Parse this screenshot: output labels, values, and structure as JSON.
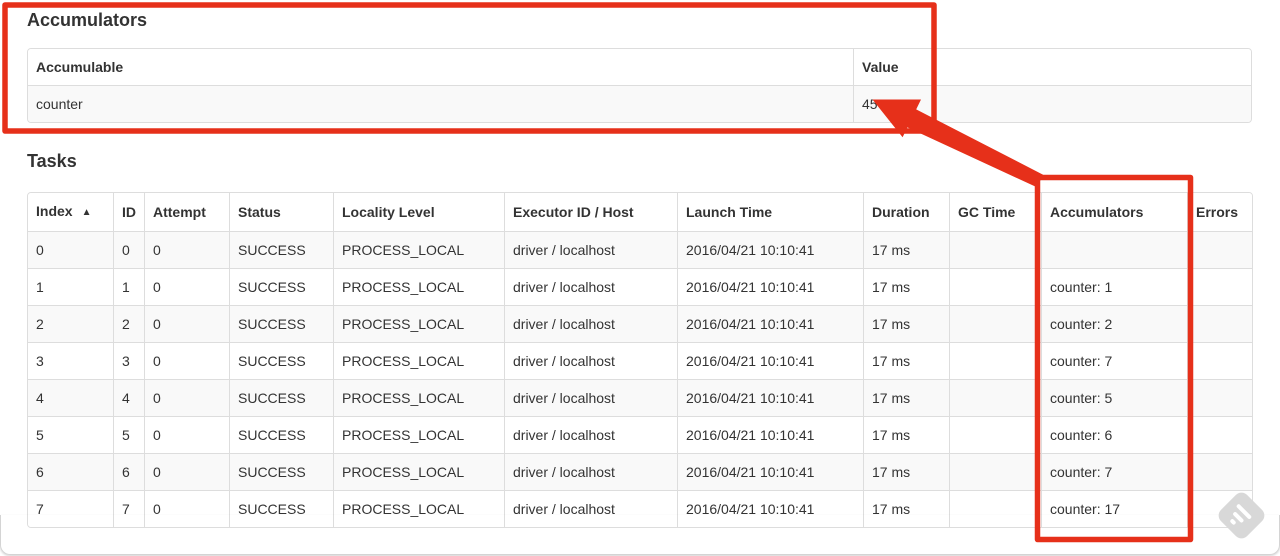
{
  "accumulators_section": {
    "heading": "Accumulators",
    "table": {
      "headers": [
        "Accumulable",
        "Value"
      ],
      "rows": [
        {
          "accumulable": "counter",
          "value": "45"
        }
      ]
    }
  },
  "tasks_section": {
    "heading": "Tasks",
    "table": {
      "sort_indicator": "▲",
      "headers": [
        "Index",
        "ID",
        "Attempt",
        "Status",
        "Locality Level",
        "Executor ID / Host",
        "Launch Time",
        "Duration",
        "GC Time",
        "Accumulators",
        "Errors"
      ],
      "rows": [
        {
          "index": "0",
          "id": "0",
          "attempt": "0",
          "status": "SUCCESS",
          "locality_level": "PROCESS_LOCAL",
          "executor": "driver / localhost",
          "launch_time": "2016/04/21 10:10:41",
          "duration": "17 ms",
          "gc_time": "",
          "accumulators": "",
          "errors": ""
        },
        {
          "index": "1",
          "id": "1",
          "attempt": "0",
          "status": "SUCCESS",
          "locality_level": "PROCESS_LOCAL",
          "executor": "driver / localhost",
          "launch_time": "2016/04/21 10:10:41",
          "duration": "17 ms",
          "gc_time": "",
          "accumulators": "counter: 1",
          "errors": ""
        },
        {
          "index": "2",
          "id": "2",
          "attempt": "0",
          "status": "SUCCESS",
          "locality_level": "PROCESS_LOCAL",
          "executor": "driver / localhost",
          "launch_time": "2016/04/21 10:10:41",
          "duration": "17 ms",
          "gc_time": "",
          "accumulators": "counter: 2",
          "errors": ""
        },
        {
          "index": "3",
          "id": "3",
          "attempt": "0",
          "status": "SUCCESS",
          "locality_level": "PROCESS_LOCAL",
          "executor": "driver / localhost",
          "launch_time": "2016/04/21 10:10:41",
          "duration": "17 ms",
          "gc_time": "",
          "accumulators": "counter: 7",
          "errors": ""
        },
        {
          "index": "4",
          "id": "4",
          "attempt": "0",
          "status": "SUCCESS",
          "locality_level": "PROCESS_LOCAL",
          "executor": "driver / localhost",
          "launch_time": "2016/04/21 10:10:41",
          "duration": "17 ms",
          "gc_time": "",
          "accumulators": "counter: 5",
          "errors": ""
        },
        {
          "index": "5",
          "id": "5",
          "attempt": "0",
          "status": "SUCCESS",
          "locality_level": "PROCESS_LOCAL",
          "executor": "driver / localhost",
          "launch_time": "2016/04/21 10:10:41",
          "duration": "17 ms",
          "gc_time": "",
          "accumulators": "counter: 6",
          "errors": ""
        },
        {
          "index": "6",
          "id": "6",
          "attempt": "0",
          "status": "SUCCESS",
          "locality_level": "PROCESS_LOCAL",
          "executor": "driver / localhost",
          "launch_time": "2016/04/21 10:10:41",
          "duration": "17 ms",
          "gc_time": "",
          "accumulators": "counter: 7",
          "errors": ""
        },
        {
          "index": "7",
          "id": "7",
          "attempt": "0",
          "status": "SUCCESS",
          "locality_level": "PROCESS_LOCAL",
          "executor": "driver / localhost",
          "launch_time": "2016/04/21 10:10:41",
          "duration": "17 ms",
          "gc_time": "",
          "accumulators": "counter: 17",
          "errors": ""
        }
      ]
    }
  },
  "annotations": {
    "color": "#e6301a"
  }
}
